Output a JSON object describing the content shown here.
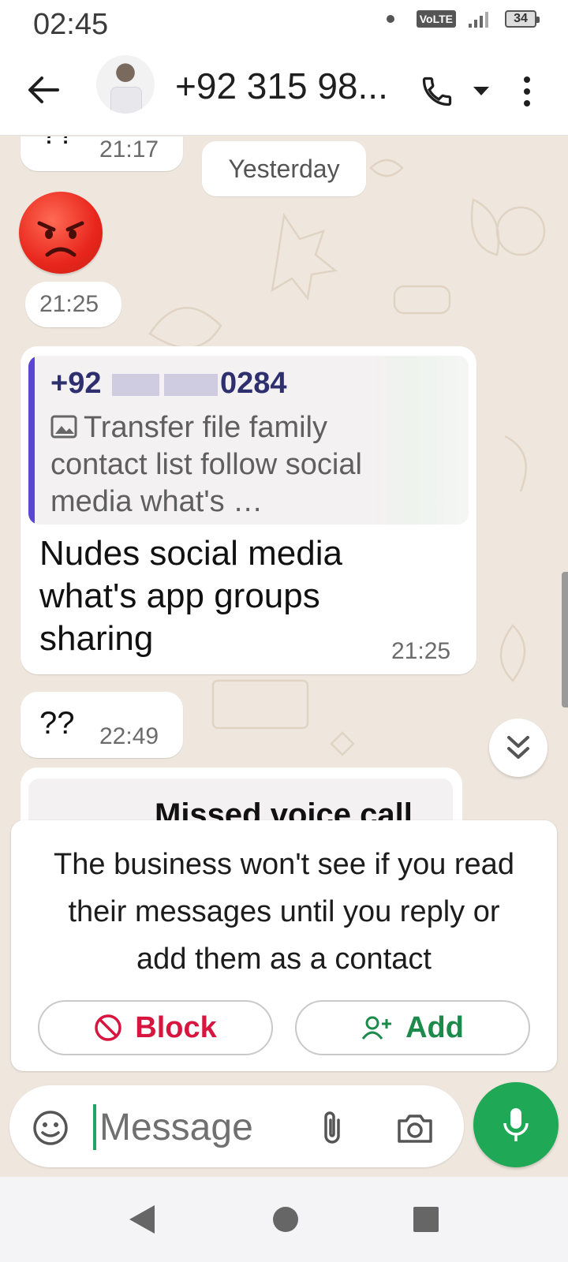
{
  "status_bar": {
    "time": "02:45",
    "network_label": "VoLTE",
    "battery": "34"
  },
  "header": {
    "contact_name": "+92 315 98..."
  },
  "chat": {
    "partial_message": {
      "text": "??",
      "time": "21:17"
    },
    "date_separator": "Yesterday",
    "emoji_message": {
      "emoji": "angry-face",
      "time": "21:25"
    },
    "reply_message": {
      "quoted_sender_prefix": "+92",
      "quoted_sender_suffix": "0284",
      "quoted_text": "Transfer file family contact list follow social media what's …",
      "text": "Nudes social media what's app groups sharing",
      "time": "21:25"
    },
    "question_message": {
      "text": "??",
      "time": "22:49"
    },
    "missed_call_label": "Missed voice call"
  },
  "notice": {
    "text": "The business won't see if you read their messages until you reply or add them as a contact",
    "block_label": "Block",
    "add_label": "Add"
  },
  "composer": {
    "placeholder": "Message"
  },
  "colors": {
    "accent_green": "#1fa855",
    "block_red": "#d6163f",
    "quote_bar": "#5b46d1",
    "chat_background": "#efe7de"
  }
}
